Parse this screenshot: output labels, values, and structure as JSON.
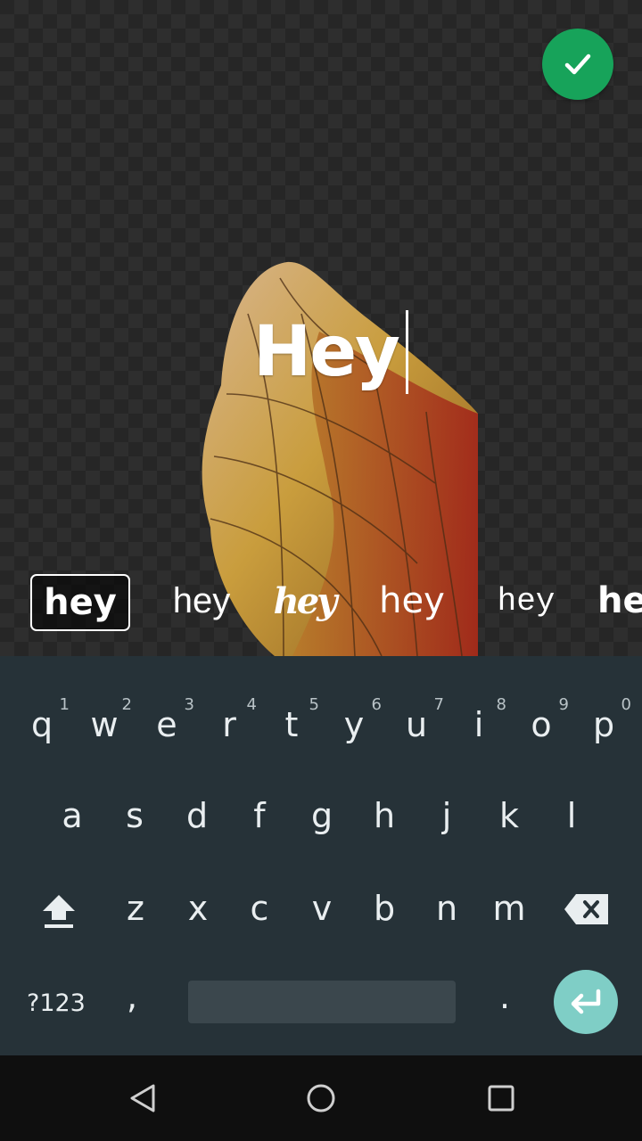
{
  "editor": {
    "sticker_text": "Hey",
    "done_icon": "check-icon",
    "accent_color": "#17a35a"
  },
  "font_options": [
    {
      "label": "hey"
    },
    {
      "label": "hey"
    },
    {
      "label": "hey"
    },
    {
      "label": "hey"
    },
    {
      "label": "hey"
    },
    {
      "label": "he"
    }
  ],
  "keyboard": {
    "row1": [
      {
        "ch": "q",
        "hint": "1"
      },
      {
        "ch": "w",
        "hint": "2"
      },
      {
        "ch": "e",
        "hint": "3"
      },
      {
        "ch": "r",
        "hint": "4"
      },
      {
        "ch": "t",
        "hint": "5"
      },
      {
        "ch": "y",
        "hint": "6"
      },
      {
        "ch": "u",
        "hint": "7"
      },
      {
        "ch": "i",
        "hint": "8"
      },
      {
        "ch": "o",
        "hint": "9"
      },
      {
        "ch": "p",
        "hint": "0"
      }
    ],
    "row2": [
      "a",
      "s",
      "d",
      "f",
      "g",
      "h",
      "j",
      "k",
      "l"
    ],
    "row3": [
      "z",
      "x",
      "c",
      "v",
      "b",
      "n",
      "m"
    ],
    "mode_label": "?123",
    "comma": ",",
    "period": ".",
    "shift_icon": "shift-arrow-icon",
    "backspace_icon": "backspace-icon",
    "enter_icon": "enter-arrow-icon",
    "enter_color": "#7fcec6"
  },
  "navigation": {
    "back_icon": "back-triangle-icon",
    "home_icon": "home-circle-icon",
    "recents_icon": "recents-square-icon"
  }
}
